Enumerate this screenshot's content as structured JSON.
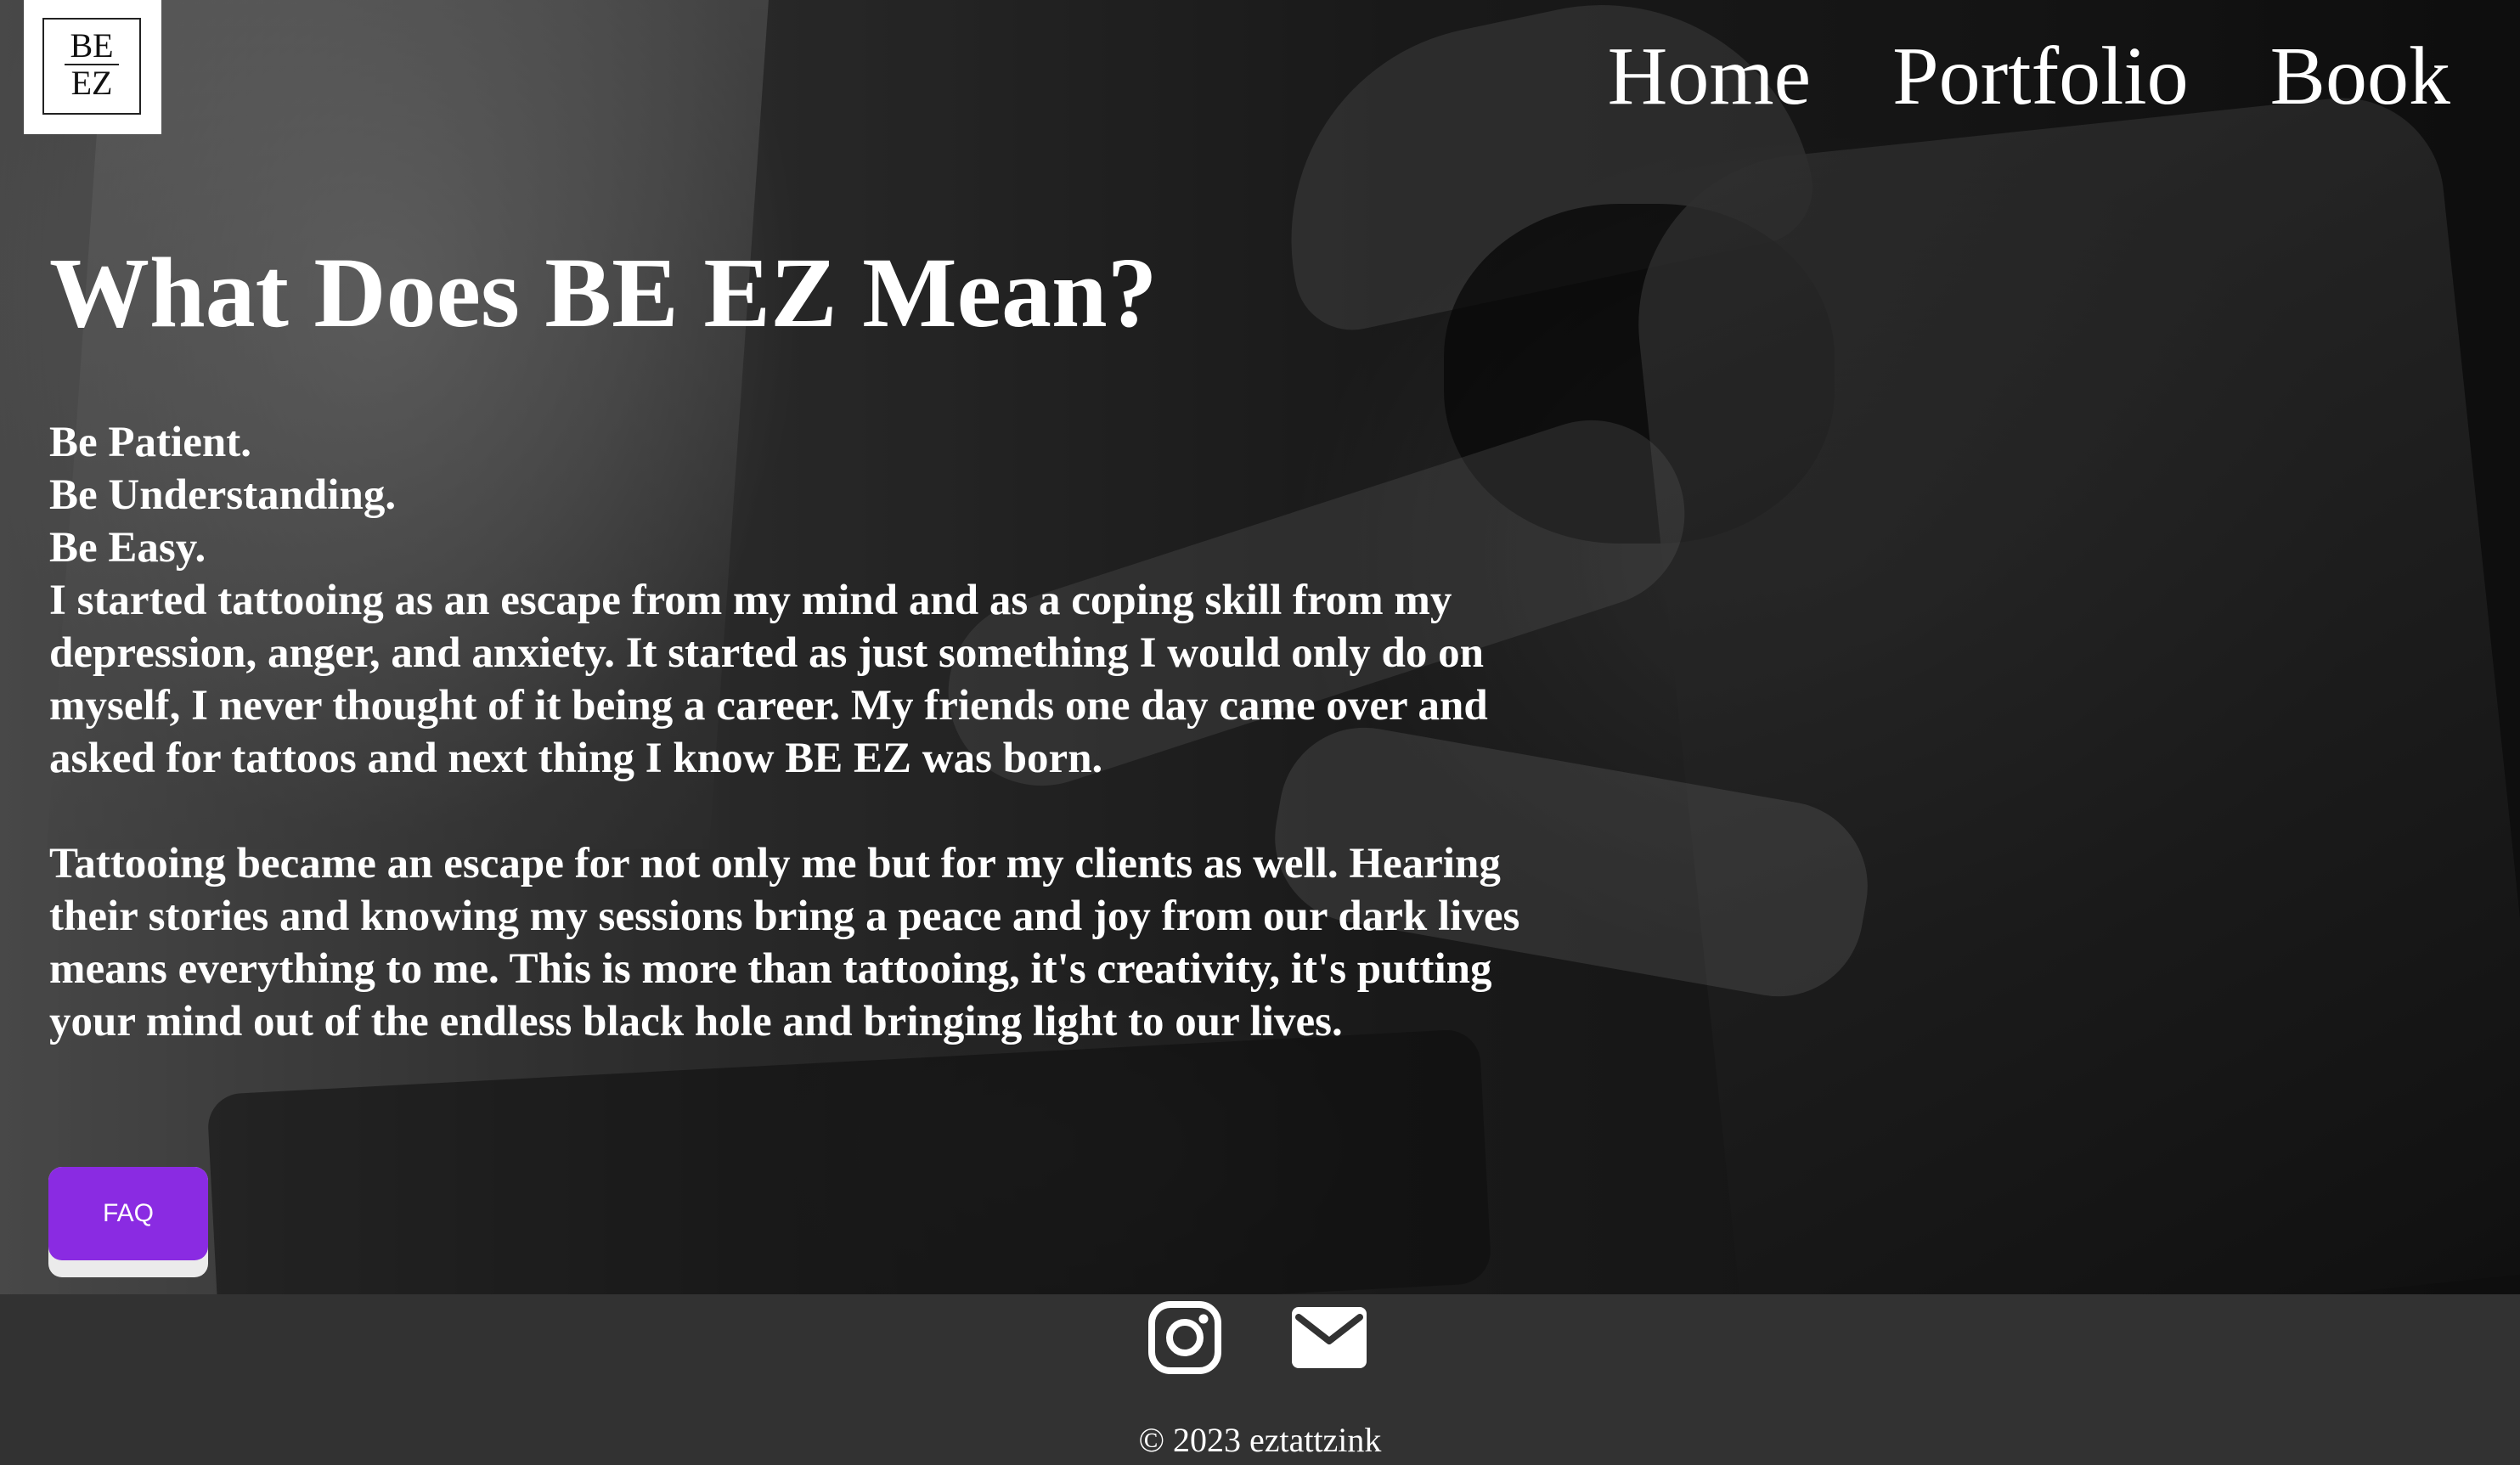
{
  "logo": {
    "top": "BE",
    "bottom": "EZ"
  },
  "nav": {
    "items": [
      {
        "label": "Home"
      },
      {
        "label": "Portfolio"
      },
      {
        "label": "Book"
      }
    ]
  },
  "main": {
    "title": "What Does BE EZ Mean?",
    "lines": [
      "Be Patient.",
      "Be Understanding.",
      "Be Easy."
    ],
    "paragraphs": [
      "I started tattooing as an escape from my mind and as a coping skill from my depression, anger, and anxiety. It started as just something I would only do on myself, I never thought of it being a career. My friends one day came over and asked for tattoos and next thing I know BE EZ was born.",
      "Tattooing became an escape for not only me but for my clients as well. Hearing their stories and knowing my sessions bring a peace and joy from our dark lives means everything to me. This is more than tattooing, it's creativity, it's putting your mind out of the endless black hole and bringing light to our lives."
    ],
    "faq_button": "FAQ"
  },
  "footer": {
    "icons": [
      "instagram-icon",
      "mail-icon"
    ],
    "copyright": "© 2023 eztattzink"
  },
  "colors": {
    "accent": "#8a2be2",
    "footer_bg": "#323232",
    "text": "#ffffff"
  }
}
